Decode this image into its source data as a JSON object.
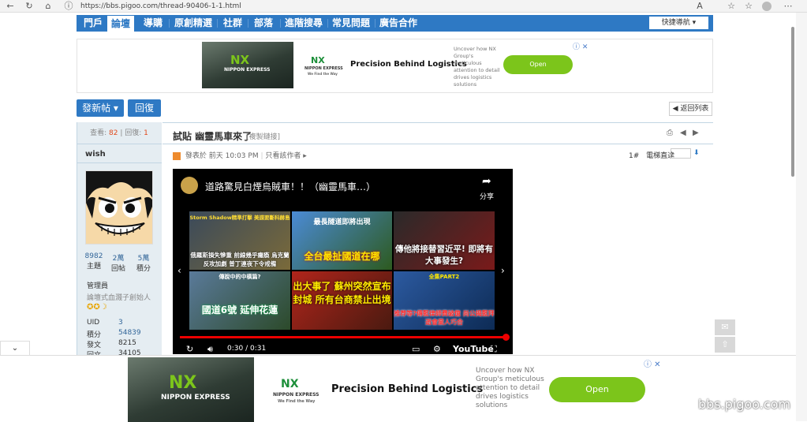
{
  "browser": {
    "url": "https://bbs.pigoo.com/thread-90406-1-1.html",
    "back_icon": "arrow-left-icon",
    "reload_icon": "reload-icon",
    "home_icon": "home-icon",
    "info_icon": "info-icon",
    "read_aloud_label": "A"
  },
  "nav": {
    "items": [
      "門戶",
      "論壇",
      "導購",
      "原創精選",
      "社群",
      "部落",
      "進階搜尋",
      "常見問題",
      "廣告合作"
    ],
    "active_index": 1,
    "quick_nav": "快捷導航 ▾"
  },
  "ad": {
    "brand_logo": "NX",
    "brand_name": "NIPPON EXPRESS",
    "tagline": "We Find the Way",
    "title": "Precision Behind Logistics",
    "body": "Uncover how NX Group's meticulous attention to detail drives logistics solutions",
    "cta": "Open"
  },
  "toolbar": {
    "new_post": "發新帖 ▾",
    "reply": "回復",
    "back_to_list": "◀ 返回列表"
  },
  "thread": {
    "views_label": "查看:",
    "views": "82",
    "replies_label": "回復:",
    "replies": "1",
    "title": "試貼 幽靈馬車來了",
    "copy_link": "[複製鏈接]",
    "posted": "發表於 前天 10:03 PM",
    "author_only": "只看該作者 ▸",
    "floor": "1#",
    "jump_label": "電梯直達"
  },
  "user": {
    "name": "wish",
    "stats": [
      {
        "value": "8982",
        "label": "主題"
      },
      {
        "value": "2萬",
        "label": "回帖"
      },
      {
        "value": "5萬",
        "label": "積分"
      }
    ],
    "role": "管理員",
    "title": "論壇式血濺子創始人",
    "fields": [
      {
        "label": "UID",
        "value": "3"
      },
      {
        "label": "積分",
        "value": "54839"
      },
      {
        "label": "發文",
        "value": "8215"
      },
      {
        "label": "回文",
        "value": "34105"
      }
    ]
  },
  "video": {
    "title": "道路驚見白煙烏賊車！！（幽靈馬車…）",
    "share": "分享",
    "time": "0:30 / 0:31",
    "brand": "YouTube",
    "thumbs": [
      {
        "caption": "俄羅斯損失慘重 前線幾乎癱瘓 烏克蘭反攻加劇 普丁連夜下令戒備",
        "top": "Storm Shadow精準打擊 美諜要斷科赫島"
      },
      {
        "caption": "全台最扯國道在哪",
        "top": "最長隧道即將出現"
      },
      {
        "caption": "傳他將接替習近平! 即將有大事發生?",
        "top": ""
      },
      {
        "caption": "國道6號 延伸花蓮",
        "top": "傳說中的中橫篇?"
      },
      {
        "caption": "出大事了 蘇州突然宣布封城 所有台商禁止出境",
        "top": ""
      },
      {
        "caption": "推荐等?傳藍律師費破億 尚公揭藍拜逝會業人巧合",
        "top": "全集PART2"
      }
    ]
  },
  "watermark": "bbs.pigoo.com"
}
